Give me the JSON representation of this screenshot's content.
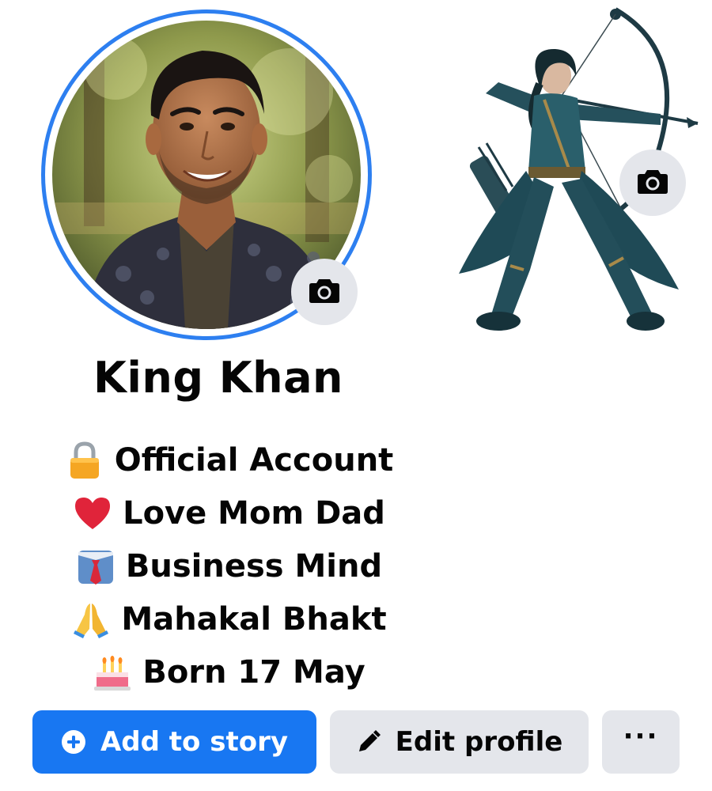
{
  "profile": {
    "name": "King Khan"
  },
  "bio": [
    {
      "icon": "lock-icon",
      "text": "Official Account"
    },
    {
      "icon": "heart-icon",
      "text": "Love Mom Dad"
    },
    {
      "icon": "necktie-icon",
      "text": "Business Mind"
    },
    {
      "icon": "folded-hands-icon",
      "text": "Mahakal Bhakt"
    },
    {
      "icon": "birthday-cake-icon",
      "text": "Born 17 May"
    }
  ],
  "actions": {
    "add_story": {
      "label": "Add to story",
      "icon": "plus-circle-icon"
    },
    "edit_profile": {
      "label": "Edit profile",
      "icon": "pencil-icon"
    },
    "more": {
      "label": "···",
      "icon": "more-icon"
    }
  },
  "colors": {
    "accent": "#1877f2",
    "ring": "#2d7ff0",
    "secondary_button": "#e4e6eb",
    "text": "#050505"
  }
}
